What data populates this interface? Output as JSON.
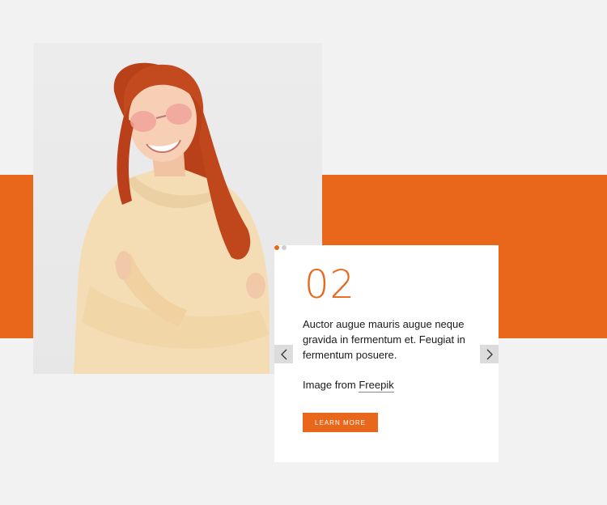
{
  "slider": {
    "number": "02",
    "description": "Auctor augue mauris augue neque gravida in fermentum et. Feugiat in fermentum posuere.",
    "credit_prefix": "Image from ",
    "credit_link": "Freepik",
    "button_label": "LEARN MORE",
    "dots": [
      {
        "active": true
      },
      {
        "active": false
      }
    ]
  },
  "icons": {
    "prev": "chevron-left-icon",
    "next": "chevron-right-icon"
  },
  "colors": {
    "accent": "#e8671b",
    "page_background": "#f2f2f2",
    "card_background": "#ffffff",
    "arrow_background": "#dcdcdc"
  }
}
